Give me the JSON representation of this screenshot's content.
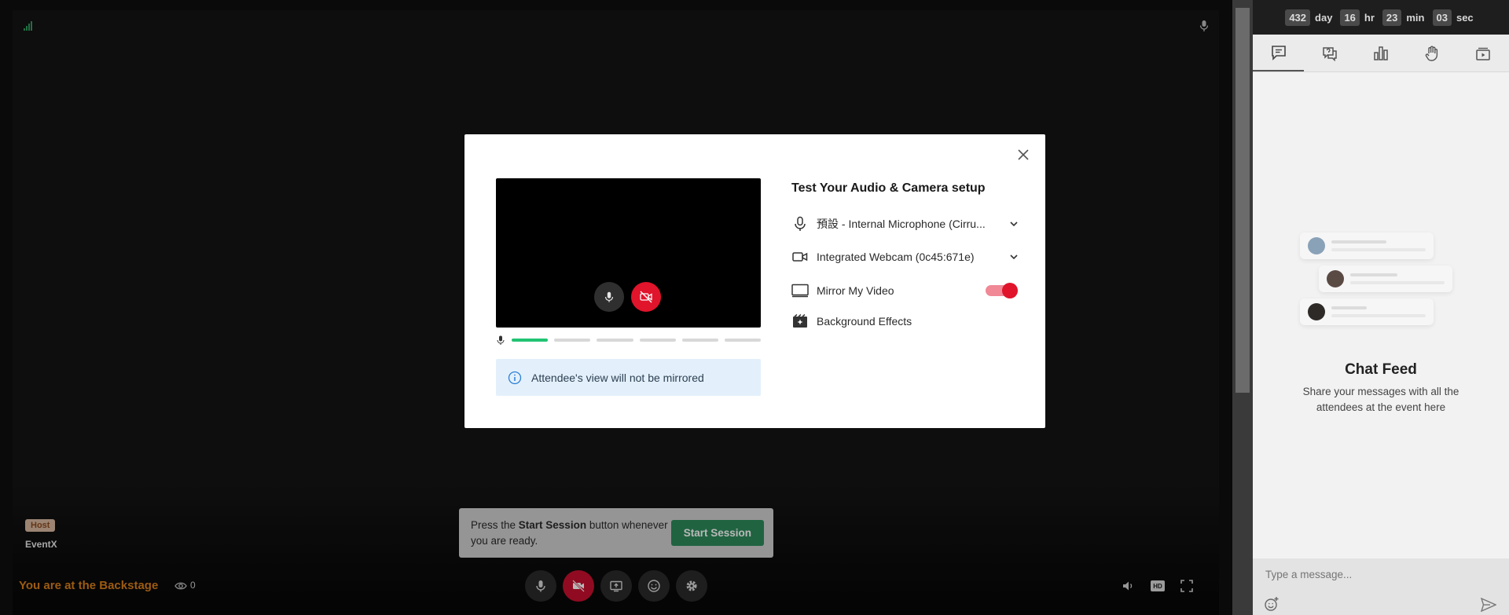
{
  "stage": {
    "host_badge": "Host",
    "host_name": "EventX",
    "backstage_label": "You are at the Backstage",
    "viewer_count": "0"
  },
  "start_session": {
    "text_before": "Press the ",
    "text_bold": "Start Session",
    "text_after": " button whenever you are ready.",
    "button_label": "Start Session"
  },
  "modal": {
    "title": "Test Your Audio & Camera setup",
    "microphone": "預設 - Internal Microphone (Cirru...",
    "camera": "Integrated Webcam (0c45:671e)",
    "mirror_label": "Mirror My Video",
    "mirror_on": true,
    "background_label": "Background Effects",
    "info_text": "Attendee's view will not be mirrored",
    "audio_level_segments": 6,
    "audio_level_active": 1
  },
  "timer": {
    "days": "432",
    "days_unit": "day",
    "hours": "16",
    "hours_unit": "hr",
    "minutes": "23",
    "minutes_unit": "min",
    "seconds": "03",
    "seconds_unit": "sec"
  },
  "sidebar": {
    "tabs": [
      "chat-icon",
      "qa-icon",
      "poll-icon",
      "raise-hand-icon",
      "media-icon"
    ],
    "chat_title": "Chat Feed",
    "chat_subtitle": "Share your messages with all the attendees at the event here",
    "chat_placeholder": "Type a message..."
  },
  "colors": {
    "accent_red": "#e0142b",
    "start_green": "#2d8a5a",
    "backstage_orange": "#d97f1a",
    "level_green": "#22c373"
  }
}
